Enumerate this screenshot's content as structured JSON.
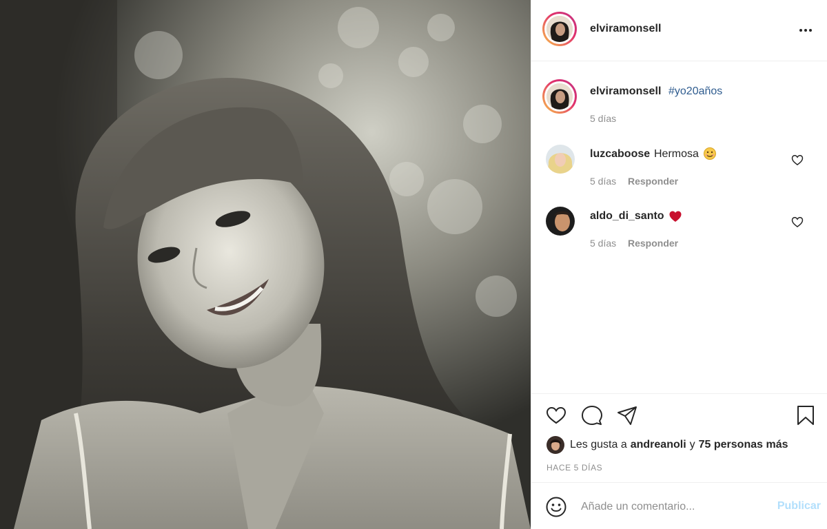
{
  "post": {
    "username": "elviramonsell",
    "caption_hashtag": "#yo20años",
    "caption_time": "5 días"
  },
  "comments": [
    {
      "user": "luzcaboose",
      "text": "Hermosa",
      "emoji": "smiling-face-emoji",
      "time": "5 días",
      "reply": "Responder"
    },
    {
      "user": "aldo_di_santo",
      "text": "",
      "emoji": "red-heart-emoji",
      "time": "5 días",
      "reply": "Responder"
    }
  ],
  "likes": {
    "prefix": "Les gusta a",
    "user": "andreanoli",
    "joiner": "y",
    "others": "75 personas más"
  },
  "date": "HACE 5 DÍAS",
  "add_comment": {
    "placeholder": "Añade un comentario...",
    "publish_label": "Publicar"
  },
  "colors": {
    "hashtag": "#2f5c8f",
    "publish_disabled": "#b2dffc",
    "heart_red": "#ed4956",
    "muted_text": "#8e8e8e"
  },
  "icons": [
    "more-icon",
    "heart-icon",
    "comment-icon",
    "share-icon",
    "bookmark-icon",
    "smiley-icon"
  ]
}
